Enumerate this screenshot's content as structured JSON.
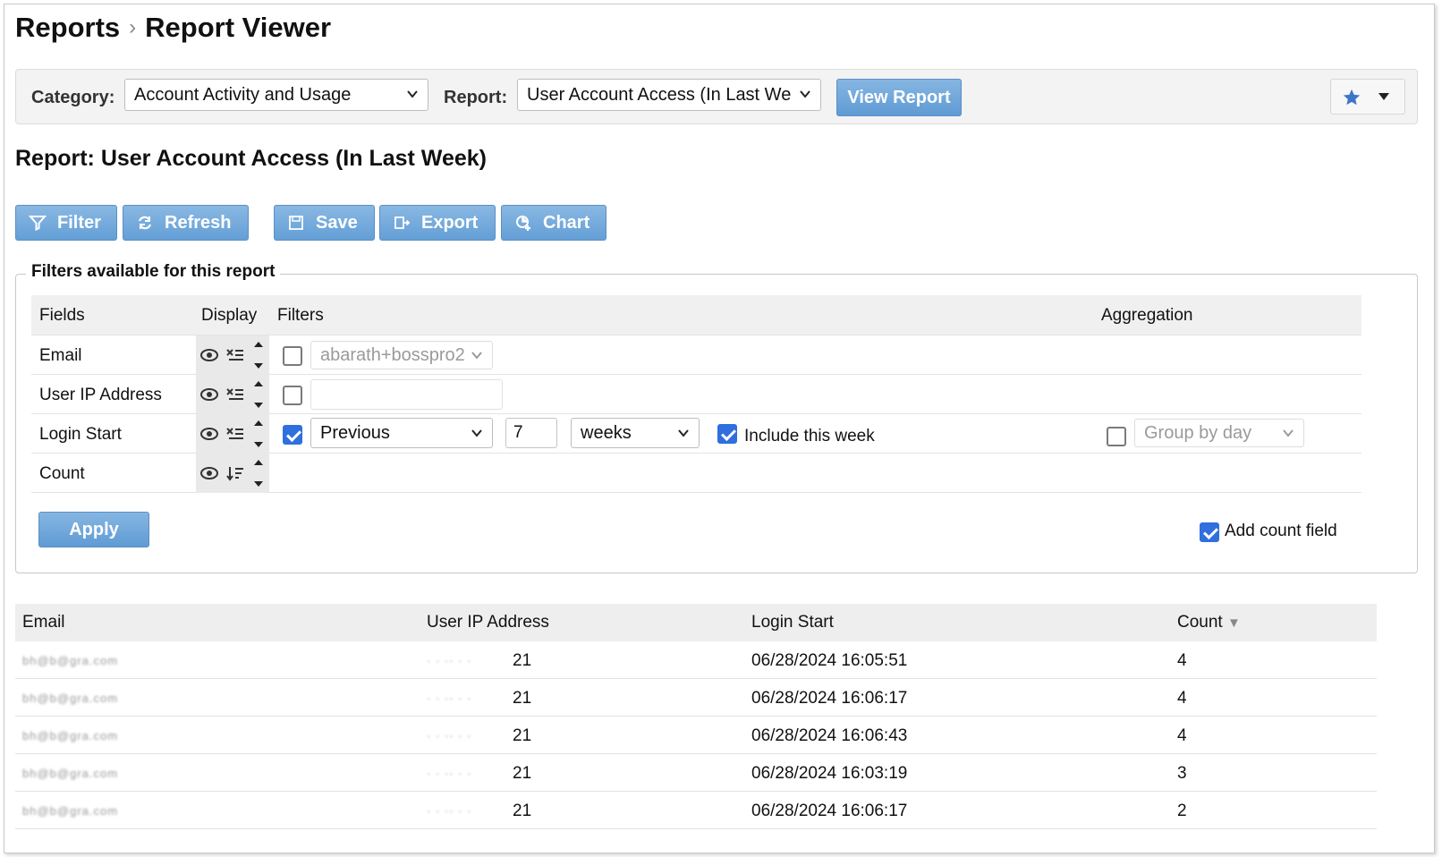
{
  "breadcrumb": {
    "root": "Reports",
    "separator": "›",
    "current": "Report Viewer"
  },
  "topbar": {
    "category_label": "Category:",
    "category_value": "Account Activity and Usage",
    "report_label": "Report:",
    "report_value": "User Account Access (In Last We",
    "view_report_label": "View Report"
  },
  "report_title": "Report: User Account Access (In Last Week)",
  "toolbar": {
    "filter": "Filter",
    "refresh": "Refresh",
    "save": "Save",
    "export": "Export",
    "chart": "Chart"
  },
  "filters": {
    "legend": "Filters available for this report",
    "headers": {
      "fields": "Fields",
      "display": "Display",
      "filters": "Filters",
      "aggregation": "Aggregation"
    },
    "rows": {
      "email": {
        "label": "Email",
        "checked": false,
        "select_value": "abarath+bosspro2"
      },
      "ip": {
        "label": "User IP Address",
        "checked": false,
        "input_value": ""
      },
      "login": {
        "label": "Login Start",
        "checked": true,
        "range_value": "Previous",
        "number_value": "7",
        "unit_value": "weeks",
        "include_label": "Include this week",
        "include_checked": true,
        "group_checked": false,
        "group_value": "Group by day"
      },
      "count": {
        "label": "Count"
      }
    },
    "apply_label": "Apply",
    "add_count_label": "Add count field",
    "add_count_checked": true
  },
  "results": {
    "headers": {
      "email": "Email",
      "ip": "User IP Address",
      "login": "Login Start",
      "count": "Count",
      "sort_indicator": "▼"
    },
    "rows": [
      {
        "email": "bh@b@gra.com",
        "ip_suffix": "21",
        "login": "06/28/2024 16:05:51",
        "count": "4"
      },
      {
        "email": "bh@b@gra.com",
        "ip_suffix": "21",
        "login": "06/28/2024 16:06:17",
        "count": "4"
      },
      {
        "email": "bh@b@gra.com",
        "ip_suffix": "21",
        "login": "06/28/2024 16:06:43",
        "count": "4"
      },
      {
        "email": "bh@b@gra.com",
        "ip_suffix": "21",
        "login": "06/28/2024 16:03:19",
        "count": "3"
      },
      {
        "email": "bh@b@gra.com",
        "ip_suffix": "21",
        "login": "06/28/2024 16:06:17",
        "count": "2"
      }
    ]
  },
  "colors": {
    "accent": "#6aa3d9",
    "checkbox_on": "#2f6fde",
    "header_bg": "#eeeeee"
  }
}
